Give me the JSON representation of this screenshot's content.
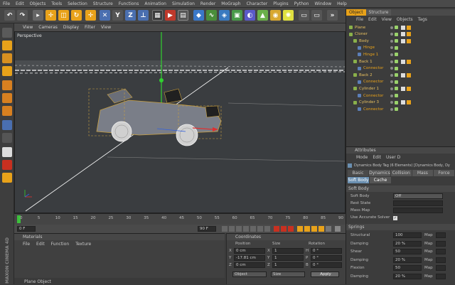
{
  "menu": [
    "File",
    "Edit",
    "Objects",
    "Tools",
    "Selection",
    "Structure",
    "Functions",
    "Animation",
    "Simulation",
    "Render",
    "MoGraph",
    "Character",
    "Plugins",
    "Python",
    "Window",
    "Help"
  ],
  "viewport": {
    "menu": [
      "View",
      "Cameras",
      "Display",
      "Filter",
      "View"
    ],
    "label": "Perspective"
  },
  "timeline": {
    "ticks": [
      "0",
      "5",
      "10",
      "15",
      "20",
      "25",
      "30",
      "35",
      "40",
      "45",
      "50",
      "55",
      "60",
      "65",
      "70",
      "75",
      "80",
      "85",
      "90"
    ],
    "start_frame": "0 F",
    "end_frame": "90 F",
    "current_frame": "0 F",
    "end_label": "0 F"
  },
  "materials": {
    "title": "Materials",
    "menu": [
      "File",
      "Edit",
      "Function",
      "Texture"
    ]
  },
  "coordinates": {
    "title": "Coordinates",
    "headers": [
      "Position",
      "Size",
      "Rotation"
    ],
    "rows": [
      {
        "axis": "X",
        "pos": "0 cm",
        "size_axis": "X",
        "size": "1",
        "rot_axis": "H",
        "rot": "0 °"
      },
      {
        "axis": "Y",
        "pos": "-17.81 cm",
        "size_axis": "Y",
        "size": "1",
        "rot_axis": "P",
        "rot": "0 °"
      },
      {
        "axis": "Z",
        "pos": "0 cm",
        "size_axis": "Z",
        "size": "1",
        "rot_axis": "B",
        "rot": "0 °"
      }
    ],
    "mode_select": "Object",
    "size_select": "Size",
    "apply_label": "Apply"
  },
  "status": {
    "text": "Plane Object"
  },
  "logo": "MAXON CINEMA 4D",
  "objects_panel": {
    "tabs": [
      "Object",
      "Structure"
    ],
    "menu": [
      "File",
      "Edit",
      "View",
      "Objects",
      "Tags"
    ],
    "items": [
      {
        "name": "Plane",
        "level": 0,
        "selected": false
      },
      {
        "name": "Cloner",
        "level": 0,
        "selected": false
      },
      {
        "name": "Body",
        "level": 1,
        "selected": false
      },
      {
        "name": "Hinge",
        "level": 2,
        "selected": false
      },
      {
        "name": "Hinge 1",
        "level": 2,
        "selected": false
      },
      {
        "name": "Back 1",
        "level": 1,
        "selected": false
      },
      {
        "name": "Connector",
        "level": 2,
        "selected": false
      },
      {
        "name": "Back 2",
        "level": 1,
        "selected": false
      },
      {
        "name": "Connector",
        "level": 2,
        "selected": false
      },
      {
        "name": "Cylinder 1",
        "level": 1,
        "selected": false
      },
      {
        "name": "Connector",
        "level": 2,
        "selected": false
      },
      {
        "name": "Cylinder 3",
        "level": 1,
        "selected": false
      },
      {
        "name": "Connector",
        "level": 2,
        "selected": false
      }
    ]
  },
  "attributes": {
    "title": "Attributes",
    "menu": [
      "Mode",
      "Edit",
      "User D"
    ],
    "tag_title": "Dynamics Body Tag (6 Elements) [Dynamics Body, Dy",
    "tabs_row1": [
      "Basic",
      "Dynamics",
      "Collision",
      "Mass",
      "Force"
    ],
    "tabs_row2": [
      "Soft Body",
      "Cache"
    ],
    "section1": "Soft Body",
    "soft_body_label": "Soft Body",
    "soft_body_value": "Off",
    "rest_state_label": "Rest State",
    "mass_map_label": "Mass Map",
    "accurate_solver_label": "Use Accurate Solver",
    "section2": "Springs",
    "springs": [
      {
        "label": "Structural",
        "value": "100",
        "map": "Map"
      },
      {
        "label": "Damping",
        "value": "20 %",
        "map": "Map"
      },
      {
        "label": "Shear",
        "value": "50",
        "map": "Map"
      },
      {
        "label": "Damping",
        "value": "20 %",
        "map": "Map"
      },
      {
        "label": "Flexion",
        "value": "50",
        "map": "Map"
      },
      {
        "label": "Damping",
        "value": "20 %",
        "map": "Map"
      }
    ]
  },
  "colors": {
    "accent": "#f0a020",
    "selected_tab": "#6a8fb0",
    "axis_red": "#e03030",
    "axis_green": "#30d030",
    "axis_blue": "#3060e0"
  }
}
